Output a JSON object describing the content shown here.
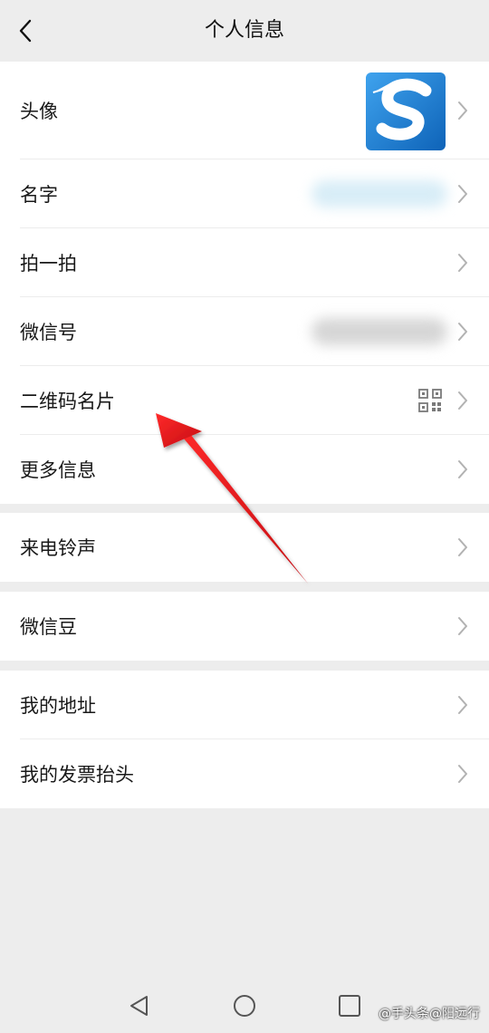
{
  "header": {
    "title": "个人信息",
    "back_icon": "chevron-left-icon"
  },
  "profile_group": {
    "rows": [
      {
        "label": "头像"
      },
      {
        "label": "名字"
      },
      {
        "label": "拍一拍"
      },
      {
        "label": "微信号"
      },
      {
        "label": "二维码名片"
      },
      {
        "label": "更多信息"
      }
    ]
  },
  "ringtone_group": {
    "label": "来电铃声"
  },
  "beans_group": {
    "label": "微信豆"
  },
  "address_group": {
    "rows": [
      {
        "label": "我的地址"
      },
      {
        "label": "我的发票抬头"
      }
    ]
  },
  "nav_bar": {
    "back_icon": "triangle-back-icon",
    "home_icon": "circle-home-icon",
    "recents_icon": "square-recents-icon"
  },
  "watermark": "@手头条@阳远行",
  "colors": {
    "background": "#ededed",
    "row_background": "#ffffff",
    "annotation_arrow": "#e8161b",
    "avatar_blue": "#1e7fd6"
  }
}
